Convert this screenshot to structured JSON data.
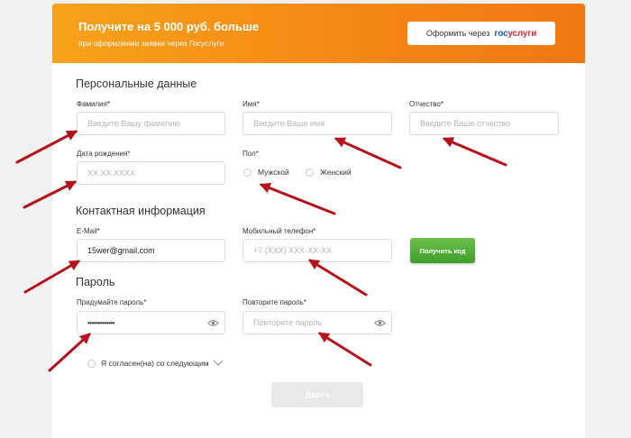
{
  "banner": {
    "title": "Получите на 5 000 руб. больше",
    "subtitle": "при оформлении заявки через Госуслуги",
    "gos_button_label": "Оформить через",
    "gos_logo_part1": "гос",
    "gos_logo_part2": "услуги"
  },
  "personal": {
    "heading": "Персональные данные",
    "surname_label": "Фамилия*",
    "surname_placeholder": "Введите Вашу фамилию",
    "name_label": "Имя*",
    "name_placeholder": "Введите Ваше имя",
    "patronymic_label": "Отчество*",
    "patronymic_placeholder": "Введите Ваше отчество",
    "birthdate_label": "Дата рождения*",
    "birthdate_placeholder": "XX.XX.XXXX",
    "gender_label": "Пол*",
    "gender_male": "Мужской",
    "gender_female": "Женский"
  },
  "contact": {
    "heading": "Контактная информация",
    "email_label": "E-Mail*",
    "email_value": "15wer@gmail.com",
    "phone_label": "Мобильный телефон*",
    "phone_placeholder": "+7 (XXX) XXX-XX-XX",
    "get_code_label": "Получить код"
  },
  "password": {
    "heading": "Пароль",
    "create_label": "Придумайте пароль*",
    "create_value": "•••••••••••••",
    "repeat_label": "Повторите пароль*",
    "repeat_placeholder": "Повторите пароль"
  },
  "agreement": {
    "text": "Я согласен(на) со следующим"
  },
  "next_button": {
    "label": "Далее"
  },
  "colors": {
    "banner_orange": "#f58a15",
    "arrow_red": "#b5121b",
    "button_green": "#4fae34",
    "gos_blue": "#1f5ca8",
    "gos_red": "#d8303b"
  }
}
